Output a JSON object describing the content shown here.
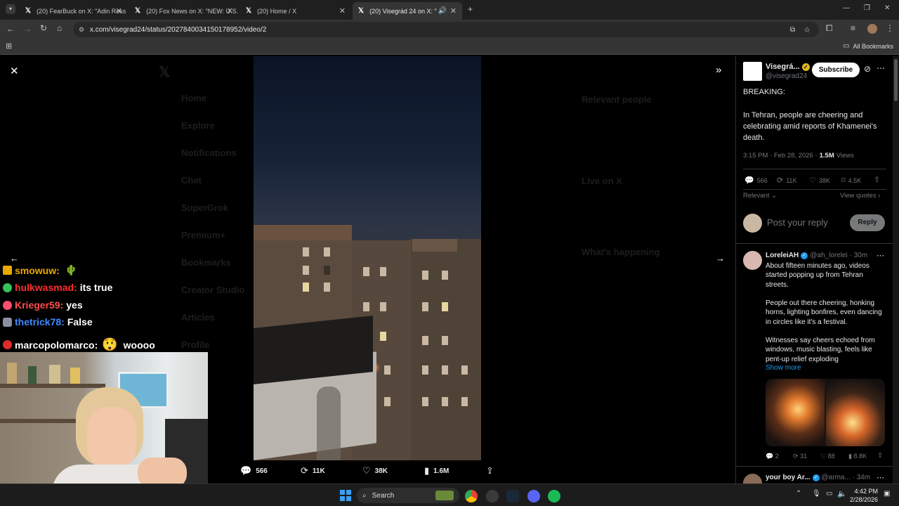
{
  "browser": {
    "tabs": [
      {
        "label": "(20) FearBuck on X: \"Adin Ross"
      },
      {
        "label": "(20) Fox News on X: \"NEW: U.S."
      },
      {
        "label": "(20) Home / X"
      },
      {
        "label": "(20) Visegrád 24 on X: \"BRE"
      }
    ],
    "url": "x.com/visegrad24/status/2027840034150178952/video/2",
    "bookmarks_label": "All Bookmarks"
  },
  "background_nav": {
    "items": [
      "Home",
      "Explore",
      "Notifications",
      "Chat",
      "SuperGrok",
      "Premium+",
      "Bookmarks",
      "Creator Studio",
      "Articles",
      "Profile"
    ],
    "right_headers": [
      "Relevant people",
      "Live on X",
      "What's happening"
    ]
  },
  "video_stats": {
    "replies": "566",
    "reposts": "11K",
    "likes": "38K",
    "views": "1.6M"
  },
  "chat": [
    {
      "user": "smowuw:",
      "message": "",
      "color": "#e8a800"
    },
    {
      "user": "hulkwasmad:",
      "message": "its true",
      "color": "#ff2d2d"
    },
    {
      "user": "Krieger59:",
      "message": "yes",
      "color": "#ff4d4d"
    },
    {
      "user": "thetrick78:",
      "message": "False",
      "color": "#3d8bff"
    },
    {
      "user": "marcopolomarco:",
      "message": "woooo",
      "color": "#ffffff"
    }
  ],
  "tweet": {
    "author": "Visegrá...",
    "handle": "@visegrad24",
    "subscribe_label": "Subscribe",
    "text_line1": "BREAKING:",
    "text_body": "In Tehran, people are cheering and celebrating amid reports of Khamenei's death.",
    "time": "3:15 PM · Feb 28, 2026 ·",
    "views_count": "1.5M",
    "views_label": "Views",
    "replies": "566",
    "reposts": "11K",
    "likes": "38K",
    "bookmarks": "4.5K",
    "sort_label": "Relevant",
    "view_quotes": "View quotes",
    "reply_placeholder": "Post your reply",
    "reply_button": "Reply"
  },
  "reply1": {
    "author": "LoreleiAH",
    "handle": "@ah_lorelei · 30m",
    "para1": "About fifteen minutes ago, videos started popping up from Tehran streets.",
    "para2": "People out there cheering, honking horns, lighting bonfires, even dancing in circles like it's a festival.",
    "para3": "Witnesses say cheers echoed from windows, music blasting, feels like pent-up relief exploding",
    "show_more": "Show more",
    "replies": "2",
    "reposts": "31",
    "likes": "88",
    "views": "8.8K"
  },
  "reply2": {
    "author": "your boy Ar...",
    "handle": "@arma... · 34m"
  },
  "taskbar": {
    "search_label": "Search",
    "time": "4:42 PM",
    "date": "2/28/2026"
  }
}
